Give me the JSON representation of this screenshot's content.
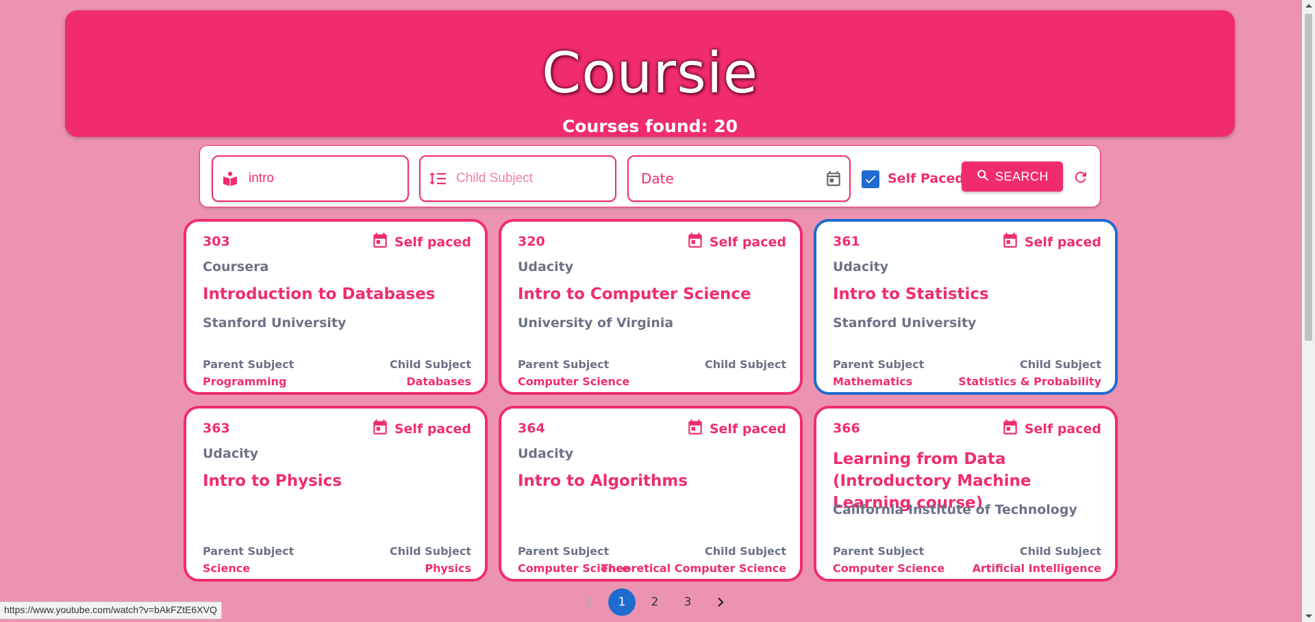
{
  "header": {
    "logo": "Coursie",
    "count_label": "Courses found: 20"
  },
  "search": {
    "query_value": "intro",
    "child_subject_placeholder": "Child Subject",
    "date_placeholder": "Date",
    "self_paced_label": "Self Paced",
    "self_paced_checked": true,
    "search_label": "SEARCH"
  },
  "labels": {
    "self_paced": "Self paced",
    "parent_subject": "Parent Subject",
    "child_subject": "Child Subject"
  },
  "courses": [
    {
      "id": "303",
      "provider": "Coursera",
      "title": "Introduction to Databases",
      "university": "Stanford University",
      "parent": "Programming",
      "child": "Databases"
    },
    {
      "id": "320",
      "provider": "Udacity",
      "title": "Intro to Computer Science",
      "university": "University of Virginia",
      "parent": "Computer Science",
      "child": ""
    },
    {
      "id": "361",
      "provider": "Udacity",
      "title": "Intro to Statistics",
      "university": "Stanford University",
      "parent": "Mathematics",
      "child": "Statistics & Probability"
    },
    {
      "id": "363",
      "provider": "Udacity",
      "title": "Intro to Physics",
      "university": "",
      "parent": "Science",
      "child": "Physics"
    },
    {
      "id": "364",
      "provider": "Udacity",
      "title": "Intro to Algorithms",
      "university": "",
      "parent": "Computer Science",
      "child": "Theoretical Computer Science"
    },
    {
      "id": "366",
      "provider": "",
      "title": "Learning from Data (Introductory Machine Learning course)",
      "university": "California Institute of Technology",
      "parent": "Computer Science",
      "child": "Artificial Intelligence"
    }
  ],
  "pagination": {
    "pages": [
      "1",
      "2",
      "3"
    ],
    "current": "1"
  },
  "status_url": "https://www.youtube.com/watch?v=bAkFZtE6XVQ",
  "colors": {
    "background": "#ec93b1",
    "accent": "#f02c6f",
    "selected": "#1f6bd0",
    "muted_text": "#6b7287"
  }
}
